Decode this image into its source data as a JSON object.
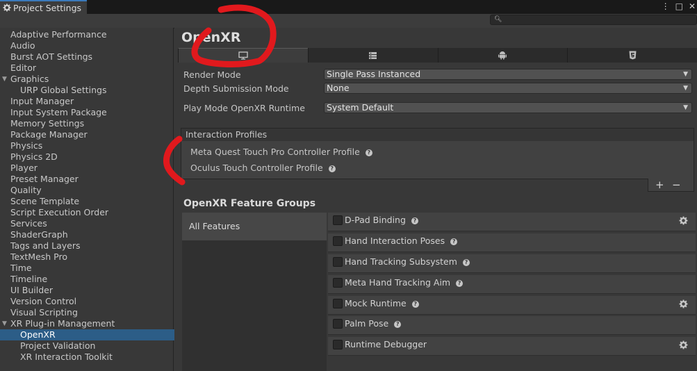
{
  "window": {
    "tab_title": "Project Settings",
    "controls": [
      "⋮",
      "□",
      "✕"
    ]
  },
  "search": {
    "placeholder": ""
  },
  "sidebar": {
    "items": [
      {
        "label": "Adaptive Performance"
      },
      {
        "label": "Audio"
      },
      {
        "label": "Burst AOT Settings"
      },
      {
        "label": "Editor"
      },
      {
        "label": "Graphics"
      },
      {
        "label": "URP Global Settings"
      },
      {
        "label": "Input Manager"
      },
      {
        "label": "Input System Package"
      },
      {
        "label": "Memory Settings"
      },
      {
        "label": "Package Manager"
      },
      {
        "label": "Physics"
      },
      {
        "label": "Physics 2D"
      },
      {
        "label": "Player"
      },
      {
        "label": "Preset Manager"
      },
      {
        "label": "Quality"
      },
      {
        "label": "Scene Template"
      },
      {
        "label": "Script Execution Order"
      },
      {
        "label": "Services"
      },
      {
        "label": "ShaderGraph"
      },
      {
        "label": "Tags and Layers"
      },
      {
        "label": "TextMesh Pro"
      },
      {
        "label": "Time"
      },
      {
        "label": "Timeline"
      },
      {
        "label": "UI Builder"
      },
      {
        "label": "Version Control"
      },
      {
        "label": "Visual Scripting"
      },
      {
        "label": "XR Plug-in Management"
      },
      {
        "label": "OpenXR"
      },
      {
        "label": "Project Validation"
      },
      {
        "label": "XR Interaction Toolkit"
      }
    ]
  },
  "main": {
    "title": "OpenXR",
    "platform_tabs": [
      "desktop-icon",
      "server-icon",
      "android-icon",
      "webgl-icon"
    ],
    "render_mode": {
      "label": "Render Mode",
      "value": "Single Pass Instanced"
    },
    "depth_submission_mode": {
      "label": "Depth Submission Mode",
      "value": "None"
    },
    "play_mode_runtime": {
      "label": "Play Mode OpenXR Runtime",
      "value": "System Default"
    },
    "interaction_profiles": {
      "header": "Interaction Profiles",
      "items": [
        {
          "label": "Meta Quest Touch Pro Controller Profile"
        },
        {
          "label": "Oculus Touch Controller Profile"
        }
      ],
      "add_label": "+",
      "remove_label": "−"
    },
    "feature_groups": {
      "title": "OpenXR Feature Groups",
      "groups": [
        "All Features"
      ],
      "features": [
        {
          "label": "D-Pad Binding",
          "checked": false,
          "has_settings": true
        },
        {
          "label": "Hand Interaction Poses",
          "checked": false,
          "has_settings": false
        },
        {
          "label": "Hand Tracking Subsystem",
          "checked": false,
          "has_settings": false
        },
        {
          "label": "Meta Hand Tracking Aim",
          "checked": false,
          "has_settings": false
        },
        {
          "label": "Mock Runtime",
          "checked": false,
          "has_settings": true
        },
        {
          "label": "Palm Pose",
          "checked": false,
          "has_settings": false
        },
        {
          "label": "Runtime Debugger",
          "checked": false,
          "has_settings": true
        }
      ]
    }
  },
  "colors": {
    "selection": "#2c5d87",
    "annotation": "#e1191d"
  }
}
